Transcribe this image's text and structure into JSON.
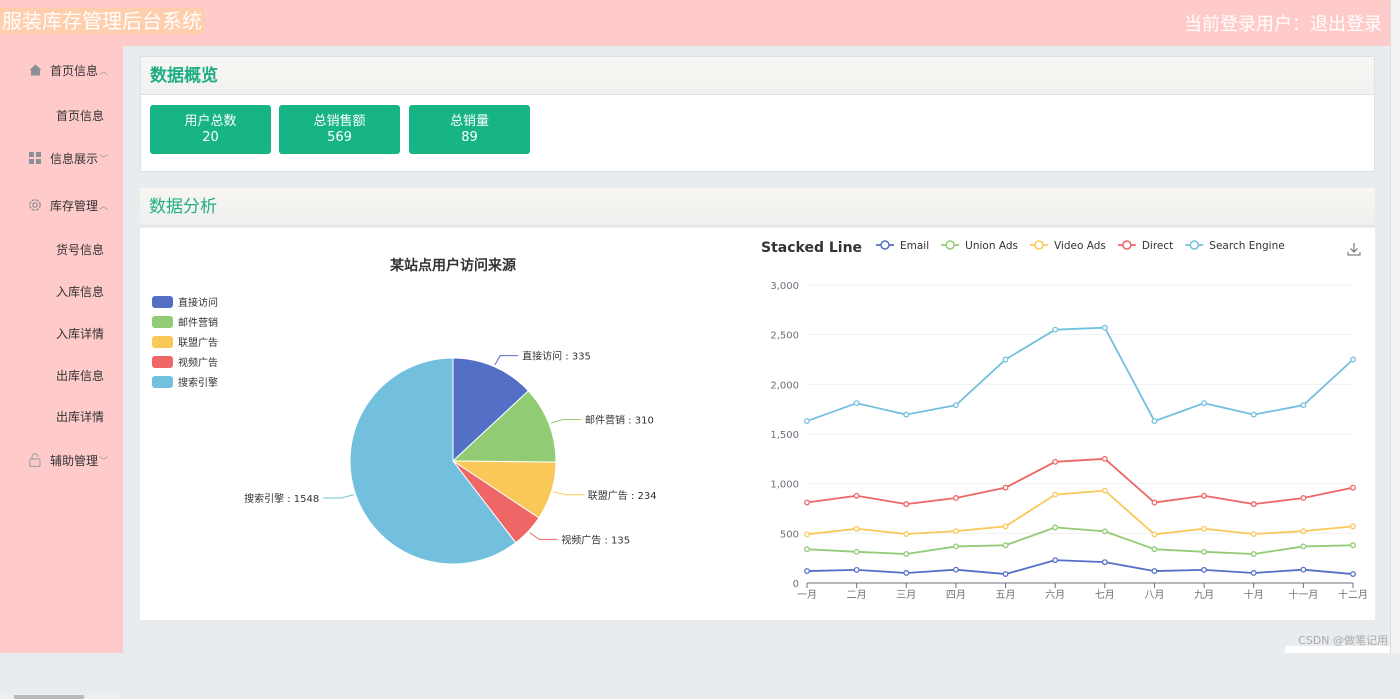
{
  "header": {
    "app_title": "服装库存管理后台系统",
    "current_user_label": "当前登录用户：",
    "logout_label": "退出登录"
  },
  "sidebar": {
    "groups": [
      {
        "label": "首页信息",
        "icon": "home-icon",
        "expanded": true,
        "items": [
          "首页信息"
        ]
      },
      {
        "label": "信息展示",
        "icon": "grid-icon",
        "expanded": false,
        "items": []
      },
      {
        "label": "库存管理",
        "icon": "gear-icon",
        "expanded": true,
        "items": [
          "货号信息",
          "入库信息",
          "入库详情",
          "出库信息",
          "出库详情"
        ]
      },
      {
        "label": "辅助管理",
        "icon": "lock-icon",
        "expanded": false,
        "items": []
      }
    ]
  },
  "overview": {
    "title": "数据概览",
    "cards": [
      {
        "label": "用户总数",
        "value": "20"
      },
      {
        "label": "总销售额",
        "value": "569"
      },
      {
        "label": "总销量",
        "value": "89"
      }
    ]
  },
  "analysis": {
    "title": "数据分析"
  },
  "watermark": "CSDN @做笔记用",
  "chart_data": [
    {
      "type": "pie",
      "title": "某站点用户访问来源",
      "legend_position": "top-left",
      "categories": [
        "直接访问",
        "邮件营销",
        "联盟广告",
        "视频广告",
        "搜索引擎"
      ],
      "values": [
        335,
        310,
        234,
        135,
        1548
      ],
      "colors": [
        "#5470c6",
        "#91cc75",
        "#fac858",
        "#ee6666",
        "#73c0de"
      ],
      "label_separator": " : "
    },
    {
      "type": "line",
      "stacked": true,
      "title": "Stacked Line",
      "legend_position": "top",
      "categories": [
        "一月",
        "二月",
        "三月",
        "四月",
        "五月",
        "六月",
        "七月",
        "八月",
        "九月",
        "十月",
        "十一月",
        "十二月"
      ],
      "series": [
        {
          "name": "Email",
          "color": "#5470c6",
          "values": [
            120,
            132,
            101,
            134,
            90,
            230,
            210,
            120,
            132,
            101,
            134,
            90
          ]
        },
        {
          "name": "Union Ads",
          "color": "#91cc75",
          "values": [
            220,
            182,
            191,
            234,
            290,
            330,
            310,
            220,
            182,
            191,
            234,
            290
          ]
        },
        {
          "name": "Video Ads",
          "color": "#fac858",
          "values": [
            150,
            232,
            201,
            154,
            190,
            330,
            410,
            150,
            232,
            201,
            154,
            190
          ]
        },
        {
          "name": "Direct",
          "color": "#ee6666",
          "values": [
            320,
            332,
            301,
            334,
            390,
            330,
            320,
            320,
            332,
            301,
            334,
            390
          ]
        },
        {
          "name": "Search Engine",
          "color": "#73c0de",
          "values": [
            820,
            932,
            901,
            934,
            1290,
            1330,
            1320,
            820,
            932,
            901,
            934,
            1290
          ]
        }
      ],
      "ylim": [
        0,
        3000
      ],
      "yticks": [
        "0",
        "500",
        "1,000",
        "1,500",
        "2,000",
        "2,500",
        "3,000"
      ],
      "grid": true,
      "toolbox": "save-as-image"
    }
  ]
}
